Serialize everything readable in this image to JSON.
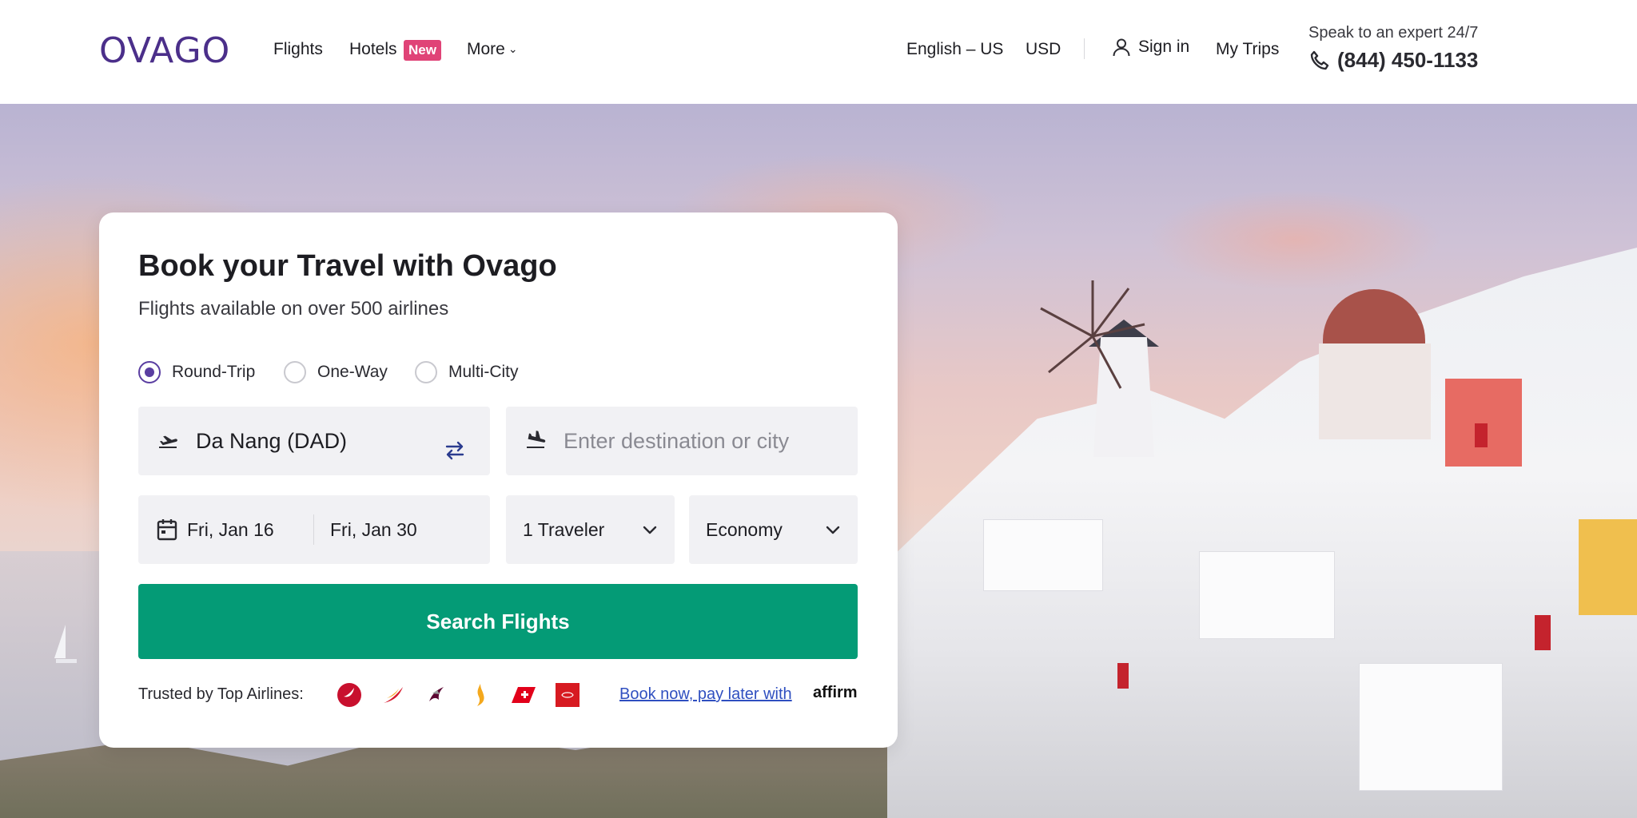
{
  "header": {
    "logo": "OVAGO",
    "nav": {
      "flights": "Flights",
      "hotels": "Hotels",
      "hotels_badge": "New",
      "more": "More"
    },
    "language": "English – US",
    "currency": "USD",
    "sign_in": "Sign in",
    "my_trips": "My Trips",
    "expert_text": "Speak to an expert 24/7",
    "phone": "(844) 450-1133"
  },
  "booking": {
    "title": "Book your Travel with Ovago",
    "subtitle": "Flights available on over 500 airlines",
    "trip_types": [
      {
        "label": "Round-Trip",
        "selected": true
      },
      {
        "label": "One-Way",
        "selected": false
      },
      {
        "label": "Multi-City",
        "selected": false
      }
    ],
    "from_value": "Da Nang (DAD)",
    "to_placeholder": "Enter destination or city",
    "depart_date": "Fri, Jan 16",
    "return_date": "Fri, Jan 30",
    "travelers": "1 Traveler",
    "cabin_class": "Economy",
    "search_button": "Search Flights",
    "trusted_label": "Trusted by Top Airlines:",
    "airline_icons": [
      "turkish-airlines-icon",
      "iberia-icon",
      "qatar-airways-icon",
      "singapore-airlines-icon",
      "swiss-icon",
      "emirates-icon"
    ],
    "pay_later_text": "Book now, pay later with",
    "affirm_logo": "affirm"
  },
  "colors": {
    "brand": "#4b2f8a",
    "radio_accent": "#5a3ea1",
    "search_button": "#049b76",
    "badge": "#e04377",
    "link": "#2f4fc0"
  }
}
